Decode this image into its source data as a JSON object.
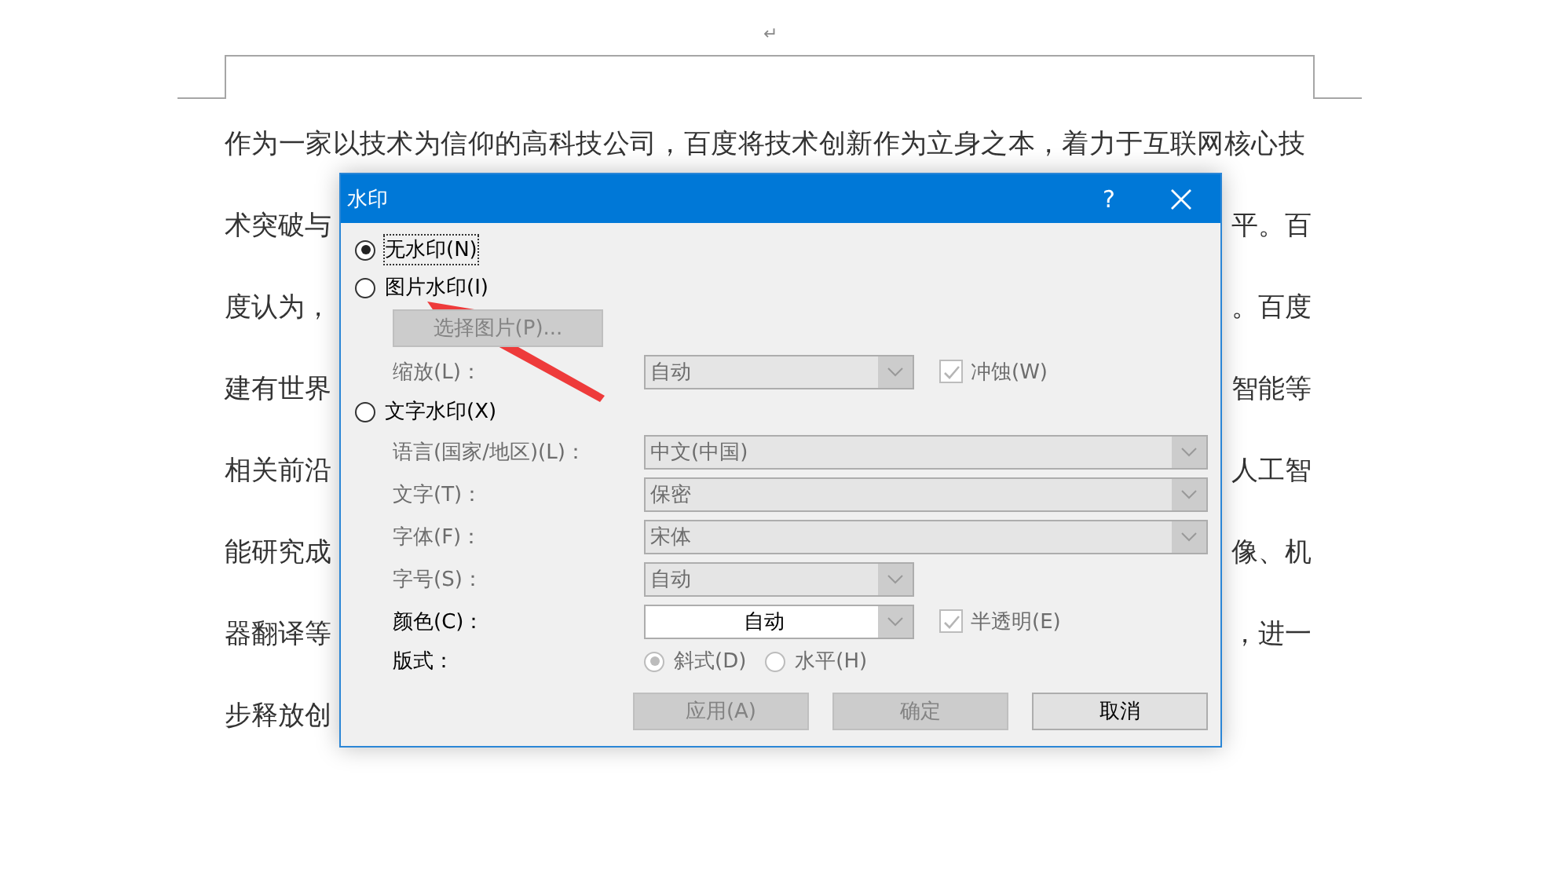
{
  "document": {
    "paragraph_mark": "↵",
    "first_line": "作为一家以技术为信仰的高科技公司，百度将技术创新作为立身之本，着力于互联网核心技",
    "lines": [
      {
        "left": "术突破与",
        "right": "平。百"
      },
      {
        "left": "度认为，",
        "right": "。百度"
      },
      {
        "left": "建有世界",
        "right": "智能等"
      },
      {
        "left": "相关前沿",
        "right": "人工智"
      },
      {
        "left": "能研究成",
        "right": "像、机"
      },
      {
        "left": "器翻译等",
        "right": "，进一"
      },
      {
        "left": "步释放创"
      }
    ]
  },
  "dialog": {
    "title": "水印",
    "help": "?",
    "options": [
      {
        "label": "无水印(N)",
        "selected": true
      },
      {
        "label": "图片水印(I)",
        "selected": false
      },
      {
        "label": "文字水印(X)",
        "selected": false
      }
    ],
    "picture_settings": {
      "select_button": {
        "label": "选择图片(P)...",
        "disabled": true
      },
      "scale": {
        "label": "缩放(L)：",
        "value": "自动",
        "disabled": true
      },
      "washout": {
        "label": "冲蚀(W)",
        "checked": true,
        "disabled": true
      }
    },
    "text_settings": {
      "fields": [
        {
          "label": "语言(国家/地区)(L)：",
          "value": "中文(中国)",
          "kind": "wide",
          "disabled": true
        },
        {
          "label": "文字(T)：",
          "value": "保密",
          "kind": "wide",
          "disabled": true
        },
        {
          "label": "字体(F)：",
          "value": "宋体",
          "kind": "wide",
          "disabled": true
        },
        {
          "label": "字号(S)：",
          "value": "自动",
          "kind": "narrow",
          "disabled": true
        },
        {
          "label": "颜色(C)：",
          "value": "自动",
          "kind": "color",
          "disabled": false
        }
      ],
      "semitransparent": {
        "label": "半透明(E)",
        "checked": true,
        "disabled": true
      },
      "layout": {
        "label": "版式：",
        "disabled": true,
        "choices": [
          {
            "label": "斜式(D)",
            "selected": true
          },
          {
            "label": "水平(H)",
            "selected": false
          }
        ]
      }
    },
    "buttons": [
      {
        "label": "应用(A)",
        "disabled": true
      },
      {
        "label": "确定",
        "disabled": true
      },
      {
        "label": "取消",
        "disabled": false
      }
    ]
  },
  "annotation": {
    "kind": "arrow"
  }
}
